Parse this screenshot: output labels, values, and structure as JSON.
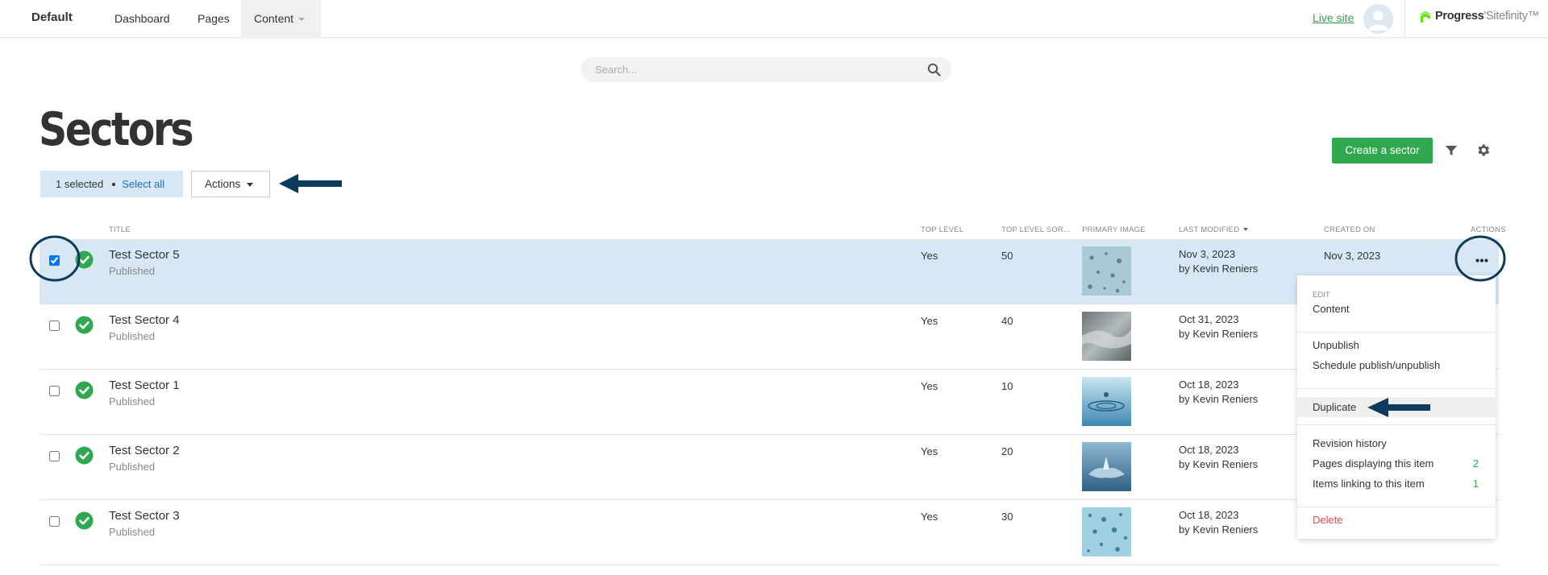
{
  "topbar": {
    "site_name": "Default",
    "nav": [
      {
        "label": "Dashboard"
      },
      {
        "label": "Pages"
      },
      {
        "label": "Content"
      }
    ],
    "live_site": "Live site",
    "brand_progress": "Progress",
    "brand_sitefinity": "Sitefinity"
  },
  "search": {
    "placeholder": "Search..."
  },
  "page": {
    "title": "Sectors"
  },
  "selection": {
    "count_label": "1 selected",
    "select_all": "Select all",
    "actions_label": "Actions"
  },
  "toolbar": {
    "create_label": "Create a sector"
  },
  "table": {
    "headers": {
      "title": "TITLE",
      "top_level": "TOP LEVEL",
      "top_level_sort": "TOP LEVEL SOR...",
      "primary_image": "PRIMARY IMAGE",
      "last_modified": "LAST MODIFIED",
      "created_on": "CREATED ON",
      "actions": "ACTIONS"
    },
    "rows": [
      {
        "title": "Test Sector 5",
        "status": "Published",
        "top_level": "Yes",
        "sort": "50",
        "modified_date": "Nov 3, 2023",
        "modified_by": "by Kevin Reniers",
        "created": "Nov 3, 2023",
        "checked": true
      },
      {
        "title": "Test Sector 4",
        "status": "Published",
        "top_level": "Yes",
        "sort": "40",
        "modified_date": "Oct 31, 2023",
        "modified_by": "by Kevin Reniers",
        "created": "",
        "checked": false
      },
      {
        "title": "Test Sector 1",
        "status": "Published",
        "top_level": "Yes",
        "sort": "10",
        "modified_date": "Oct 18, 2023",
        "modified_by": "by Kevin Reniers",
        "created": "",
        "checked": false
      },
      {
        "title": "Test Sector 2",
        "status": "Published",
        "top_level": "Yes",
        "sort": "20",
        "modified_date": "Oct 18, 2023",
        "modified_by": "by Kevin Reniers",
        "created": "",
        "checked": false
      },
      {
        "title": "Test Sector 3",
        "status": "Published",
        "top_level": "Yes",
        "sort": "30",
        "modified_date": "Oct 18, 2023",
        "modified_by": "by Kevin Reniers",
        "created": "",
        "checked": false
      }
    ]
  },
  "menu": {
    "edit_header": "EDIT",
    "content": "Content",
    "unpublish": "Unpublish",
    "schedule": "Schedule publish/unpublish",
    "duplicate": "Duplicate",
    "revision_history": "Revision history",
    "pages_displaying": "Pages displaying this item",
    "pages_displaying_count": "2",
    "items_linking": "Items linking to this item",
    "items_linking_count": "1",
    "delete": "Delete"
  },
  "colors": {
    "accent_green": "#2fa84f",
    "selected_row": "#d7e8f4",
    "link_blue": "#1d6fb8",
    "danger": "#e04b4b",
    "annotation_navy": "#0d3b5c"
  },
  "icons": [
    "search-icon",
    "filter-icon",
    "gear-icon",
    "check-circle-icon",
    "more-horizontal-icon",
    "user-avatar-icon",
    "progress-logo-icon",
    "chevron-down-icon"
  ]
}
